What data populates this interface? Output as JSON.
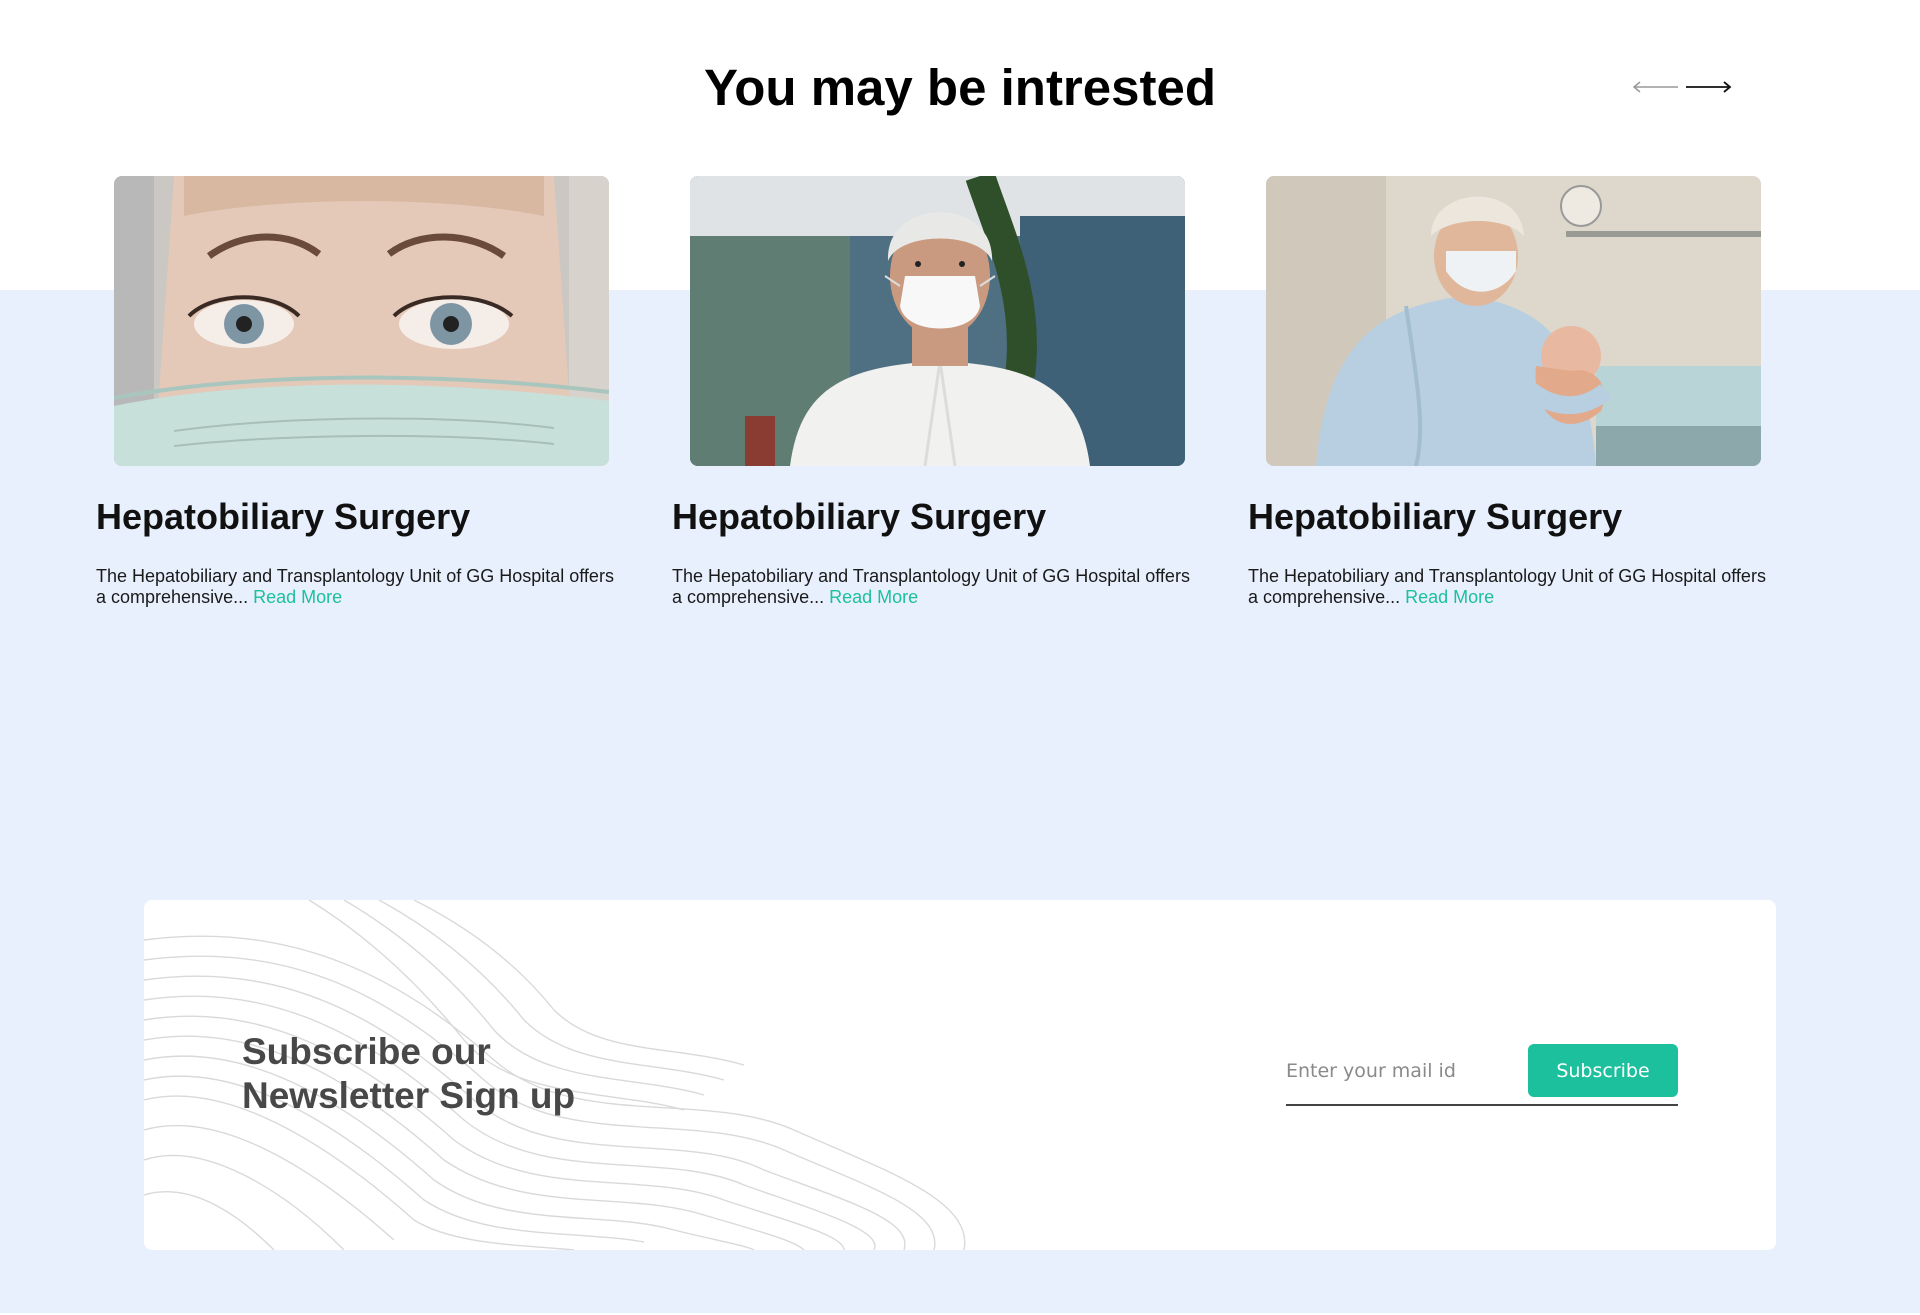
{
  "section": {
    "heading": "You may be intrested"
  },
  "carousel": {
    "prev_icon": "arrow-left-icon",
    "next_icon": "arrow-right-icon",
    "cards": [
      {
        "image": "masked-woman-eyes-photo",
        "title": "Hepatobiliary Surgery",
        "description": "The Hepatobiliary and Transplantology Unit of GG Hospital offers a comprehensive...",
        "read_more": "Read More"
      },
      {
        "image": "masked-man-photo",
        "title": "Hepatobiliary Surgery",
        "description": "The Hepatobiliary and Transplantology Unit of GG Hospital offers a comprehensive...",
        "read_more": "Read More"
      },
      {
        "image": "surgeon-holding-newborn-photo",
        "title": "Hepatobiliary Surgery",
        "description": "The Hepatobiliary and Transplantology Unit of GG Hospital offers a comprehensive...",
        "read_more": "Read More"
      }
    ]
  },
  "newsletter": {
    "title_line1": "Subscribe our",
    "title_line2": "Newsletter Sign up",
    "input_placeholder": "Enter your mail id",
    "button_label": "Subscribe"
  },
  "colors": {
    "accent": "#1cc09c",
    "band_background": "#e8f0fd",
    "card_background": "#ffffff",
    "newsletter_title": "#484848"
  }
}
